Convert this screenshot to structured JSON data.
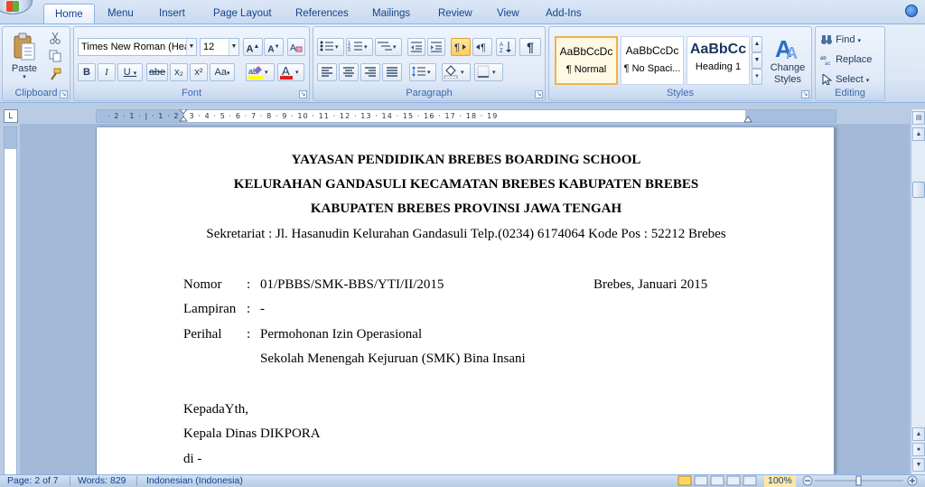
{
  "tabs": [
    "Home",
    "Menu",
    "Insert",
    "Page Layout",
    "References",
    "Mailings",
    "Review",
    "View",
    "Add-Ins"
  ],
  "active_tab": "Home",
  "ribbon": {
    "clipboard": {
      "label": "Clipboard",
      "paste": "Paste"
    },
    "font": {
      "label": "Font",
      "font_name": "Times New Roman (Hea",
      "font_size": "12",
      "buttons": [
        "B",
        "I",
        "U",
        "abe",
        "x₂",
        "x²",
        "Aa"
      ]
    },
    "paragraph": {
      "label": "Paragraph"
    },
    "styles": {
      "label": "Styles",
      "items": [
        {
          "sample": "AaBbCcDc",
          "name": "¶ Normal"
        },
        {
          "sample": "AaBbCcDc",
          "name": "¶ No Spaci..."
        },
        {
          "sample": "AaBbCc",
          "name": "Heading 1"
        }
      ],
      "change_styles": "Change Styles"
    },
    "editing": {
      "label": "Editing",
      "find": "Find",
      "replace": "Replace",
      "select": "Select"
    }
  },
  "document": {
    "header_lines": [
      "YAYASAN PENDIDIKAN BREBES BOARDING SCHOOL",
      "KELURAHAN GANDASULI  KECAMATAN BREBES KABUPATEN BREBES",
      "KABUPATEN BREBES PROVINSI JAWA TENGAH"
    ],
    "address": "Sekretariat : Jl. Hasanudin Kelurahan Gandasuli Telp.(0234) 6174064  Kode Pos : 52212 Brebes",
    "nomor_label": "Nomor",
    "nomor_value": "01/PBBS/SMK-BBS/YTI/II/2015",
    "date": "Brebes, Januari 2015",
    "lampiran_label": "Lampiran",
    "lampiran_value": "-",
    "perihal_label": "Perihal",
    "perihal_value_1": "Permohonan Izin Operasional",
    "perihal_value_2": "Sekolah Menengah Kejuruan (SMK) Bina Insani",
    "colon": ":",
    "greeting": "KepadaYth,",
    "recipient": "Kepala Dinas DIKPORA",
    "place": "di -"
  },
  "ruler_numbers": "· 2 · 1 · | · 1 · 2 · 3 · 4 · 5 · 6 · 7 · 8 · 9 · 10 · 11 · 12 · 13 · 14 · 15 · 16 · 17 · 18 · 19",
  "status": {
    "page": "Page: 2 of 7",
    "words": "Words: 829",
    "language": "Indonesian (Indonesia)",
    "zoom": "100%"
  },
  "colors": {
    "tab_text": "#15428b",
    "ribbon_bg": "#dbe6f5",
    "doc_bg": "#a2b9d7"
  }
}
